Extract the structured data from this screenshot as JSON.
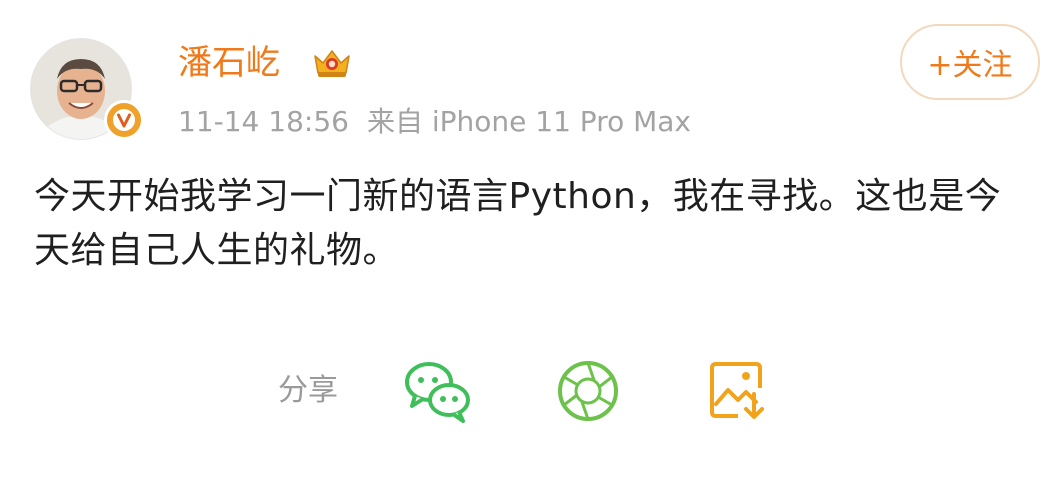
{
  "post": {
    "author": {
      "name": "潘石屹",
      "verified_badge_text": "V"
    },
    "timestamp": "11-14 18:56",
    "source": "来自 iPhone 11 Pro Max",
    "follow_label": "+关注",
    "text": "今天开始我学习一门新的语言Python，我在寻找。这也是今天给自己人生的礼物。"
  },
  "share": {
    "label": "分享",
    "targets": [
      {
        "icon": "wechat-icon"
      },
      {
        "icon": "moments-icon"
      },
      {
        "icon": "save-image-icon"
      }
    ]
  },
  "colors": {
    "accent_orange": "#f07a1a",
    "meta_gray": "#a3a3a3",
    "wechat_green": "#3fbf5a",
    "moments_green": "#6cc24a",
    "save_orange": "#f2a31c"
  }
}
